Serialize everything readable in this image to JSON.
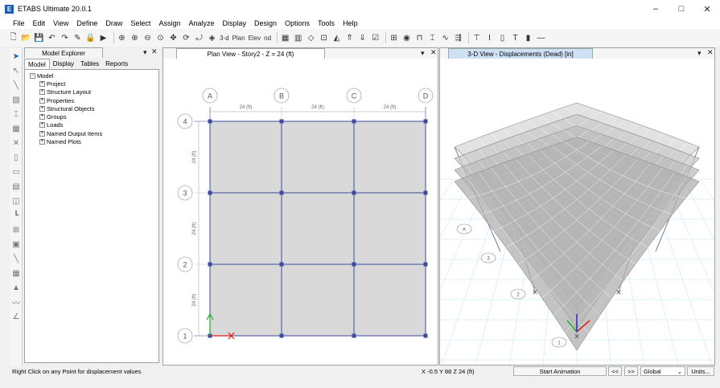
{
  "app": {
    "title": "ETABS Ultimate 20.0.1",
    "icon_letter": "E"
  },
  "window_controls": {
    "minimize": "–",
    "maximize": "□",
    "close": "✕"
  },
  "menu": [
    "File",
    "Edit",
    "View",
    "Define",
    "Draw",
    "Select",
    "Assign",
    "Analyze",
    "Display",
    "Design",
    "Options",
    "Tools",
    "Help"
  ],
  "toolbar": {
    "icons": [
      "new-icon",
      "open-icon",
      "save-icon",
      "undo-icon",
      "redo-icon",
      "pencil-icon",
      "lock-icon",
      "run-icon",
      "zoom-window-icon",
      "zoom-in-icon",
      "zoom-out-icon",
      "zoom-restore-icon",
      "pan-icon",
      "refresh-icon",
      "rotate-icon",
      "view-3d-icon",
      "plan-icon",
      "elevation-icon",
      "nd-icon",
      "rubber-band-icon",
      "perspective-icon",
      "move-up-icon",
      "move-down-icon",
      "set-display-icon",
      "object-shrink-icon",
      "display-icon",
      "frame-icon",
      "section-icon",
      "deformed-icon",
      "forces-icon",
      "story-icon",
      "beam-icon",
      "column-icon",
      "brace-icon",
      "wall-icon",
      "dimension-icon"
    ],
    "view_labels": {
      "v3d": "3-d",
      "plan": "Plan",
      "elev": "Elev",
      "nd": "nd"
    }
  },
  "explorer": {
    "title": "Model Explorer",
    "tabs": [
      "Model",
      "Display",
      "Tables",
      "Reports"
    ],
    "active_tab": "Model",
    "root": "Model",
    "items": [
      "Project",
      "Structure Layout",
      "Properties",
      "Structural Objects",
      "Groups",
      "Loads",
      "Named Output Items",
      "Named Plots"
    ]
  },
  "plan_view": {
    "title": "Plan View - Story2 - Z = 24 (ft)",
    "grid_x": [
      "A",
      "B",
      "C",
      "D"
    ],
    "grid_y": [
      "4",
      "3",
      "2",
      "1"
    ],
    "spacing_labels_x": [
      "24 (ft)",
      "24 (ft)",
      "24 (ft)"
    ],
    "spacing_labels_y": [
      "24 (ft)",
      "24 (ft)",
      "24 (ft)"
    ]
  },
  "view3d": {
    "title": "3-D View  - Displacements (Dead)  [in]",
    "grid_bubbles": [
      "A",
      "3",
      "2",
      "1"
    ]
  },
  "status": {
    "message": "Right Click on any Point for displacement values",
    "coords": "X -0.5  Y 88  Z 24 (ft)",
    "start_animation": "Start Animation",
    "prev": "<<",
    "next": ">>",
    "coord_system": "Global",
    "units": "Units..."
  },
  "colors": {
    "grid_line": "#3b4ba0",
    "slab_fill": "#d9d9d9",
    "active_tab": "#cfe0f5",
    "axis_x": "#e01c1c",
    "axis_y": "#1fae1f",
    "axis_z": "#2222cc"
  }
}
